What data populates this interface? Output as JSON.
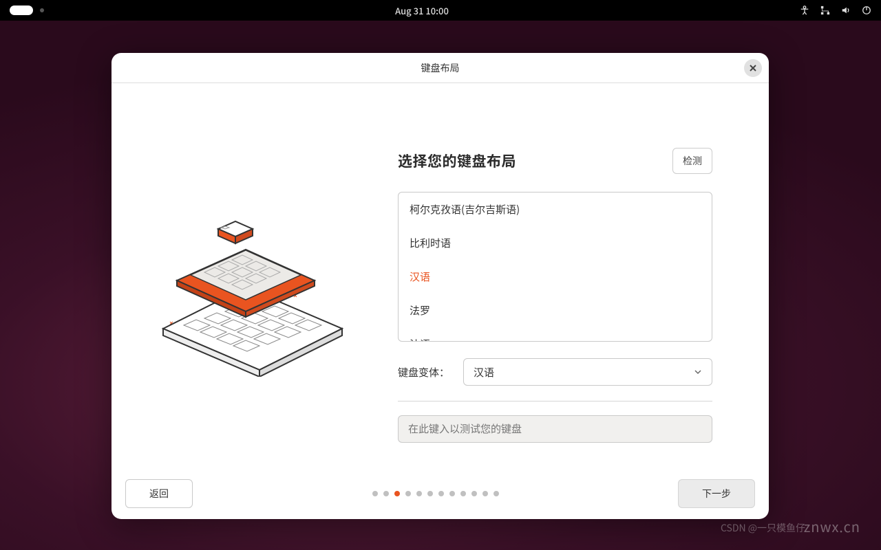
{
  "topbar": {
    "datetime": "Aug 31  10:00"
  },
  "dialog": {
    "title": "键盘布局",
    "heading": "选择您的键盘布局",
    "detect_label": "检测",
    "layouts": [
      {
        "label": "柯尔克孜语(吉尔吉斯语)",
        "selected": false
      },
      {
        "label": "比利时语",
        "selected": false
      },
      {
        "label": "汉语",
        "selected": true
      },
      {
        "label": "法罗",
        "selected": false
      },
      {
        "label": "法语",
        "selected": false
      }
    ],
    "variant": {
      "label": "键盘变体：",
      "value": "汉语"
    },
    "test_placeholder": "在此键入以测试您的键盘",
    "back_label": "返回",
    "next_label": "下一步",
    "step": {
      "current": 3,
      "total": 12
    }
  },
  "watermarks": {
    "primary": "znwx.cn",
    "secondary": "CSDN @一只模鱼仔"
  },
  "colors": {
    "accent": "#e95420"
  }
}
